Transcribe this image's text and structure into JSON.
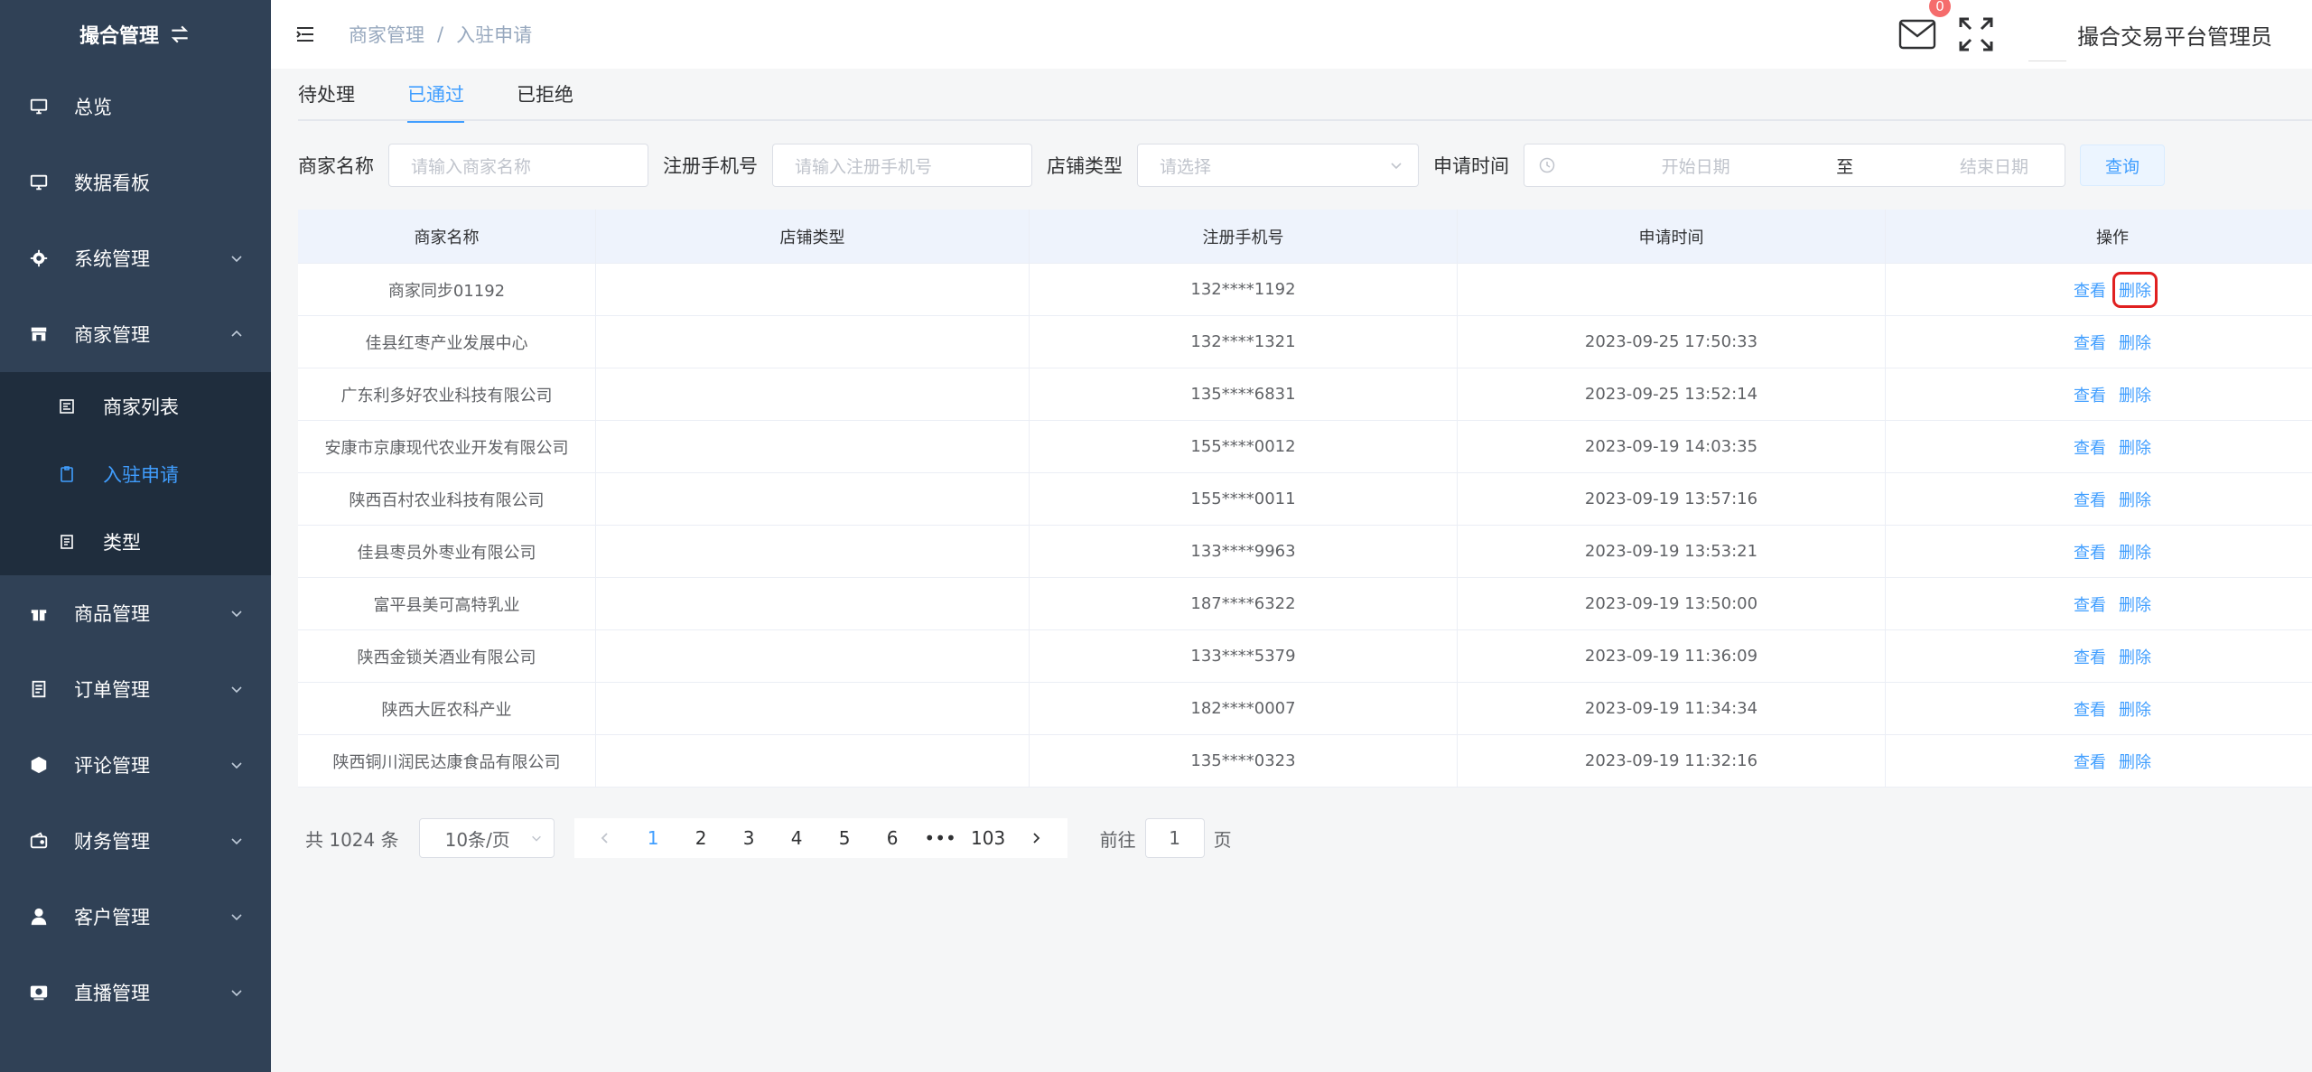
{
  "sidebar": {
    "logo_text": "撮合管理",
    "items": [
      {
        "label": "总览",
        "icon": "monitor-icon"
      },
      {
        "label": "数据看板",
        "icon": "monitor-icon"
      },
      {
        "label": "系统管理",
        "icon": "gear-icon"
      },
      {
        "label": "商家管理",
        "icon": "shop-icon"
      },
      {
        "label": "商品管理",
        "icon": "gift-icon"
      },
      {
        "label": "订单管理",
        "icon": "document-icon"
      },
      {
        "label": "评论管理",
        "icon": "comment-icon"
      },
      {
        "label": "财务管理",
        "icon": "wallet-icon"
      },
      {
        "label": "客户管理",
        "icon": "user-icon"
      },
      {
        "label": "直播管理",
        "icon": "video-icon"
      }
    ],
    "sub_items": [
      {
        "label": "商家列表",
        "icon": "list-icon"
      },
      {
        "label": "入驻申请",
        "icon": "clipboard-icon"
      },
      {
        "label": "类型",
        "icon": "document-icon"
      }
    ],
    "active_color": "#409eff",
    "bg_color": "#304156"
  },
  "header": {
    "breadcrumb": [
      "商家管理",
      "/",
      "入驻申请"
    ],
    "badge_count": "0",
    "admin_name": "撮合交易平台管理员"
  },
  "tabs": [
    "待处理",
    "已通过",
    "已拒绝"
  ],
  "filters": {
    "merchant_label": "商家名称",
    "merchant_placeholder": "请输入商家名称",
    "phone_label": "注册手机号",
    "phone_placeholder": "请输入注册手机号",
    "store_label": "店铺类型",
    "store_placeholder": "请选择",
    "time_label": "申请时间",
    "start_placeholder": "开始日期",
    "range_sep": "至",
    "end_placeholder": "结束日期",
    "query_button": "查询"
  },
  "table": {
    "headers": [
      "商家名称",
      "店铺类型",
      "注册手机号",
      "申请时间",
      "操作"
    ],
    "view_label": "查看",
    "delete_label": "删除",
    "rows": [
      {
        "name": "商家同步01192",
        "type": "",
        "phone": "132****1192",
        "time": ""
      },
      {
        "name": "佳县红枣产业发展中心",
        "type": "",
        "phone": "132****1321",
        "time": "2023-09-25 17:50:33"
      },
      {
        "name": "广东利多好农业科技有限公司",
        "type": "",
        "phone": "135****6831",
        "time": "2023-09-25 13:52:14"
      },
      {
        "name": "安康市京康现代农业开发有限公司",
        "type": "",
        "phone": "155****0012",
        "time": "2023-09-19 14:03:35"
      },
      {
        "name": "陕西百村农业科技有限公司",
        "type": "",
        "phone": "155****0011",
        "time": "2023-09-19 13:57:16"
      },
      {
        "name": "佳县枣员外枣业有限公司",
        "type": "",
        "phone": "133****9963",
        "time": "2023-09-19 13:53:21"
      },
      {
        "name": "富平县美可高特乳业",
        "type": "",
        "phone": "187****6322",
        "time": "2023-09-19 13:50:00"
      },
      {
        "name": "陕西金锁关酒业有限公司",
        "type": "",
        "phone": "133****5379",
        "time": "2023-09-19 11:36:09"
      },
      {
        "name": "陕西大匠农科产业",
        "type": "",
        "phone": "182****0007",
        "time": "2023-09-19 11:34:34"
      },
      {
        "name": "陕西铜川润民达康食品有限公司",
        "type": "",
        "phone": "135****0323",
        "time": "2023-09-19 11:32:16"
      }
    ]
  },
  "pagination": {
    "total": "共 1024 条",
    "page_size": "10条/页",
    "pages": [
      "1",
      "2",
      "3",
      "4",
      "5",
      "6"
    ],
    "ellipsis": "•••",
    "last": "103",
    "goto_label": "前往",
    "goto_value": "1",
    "goto_suffix": "页"
  }
}
